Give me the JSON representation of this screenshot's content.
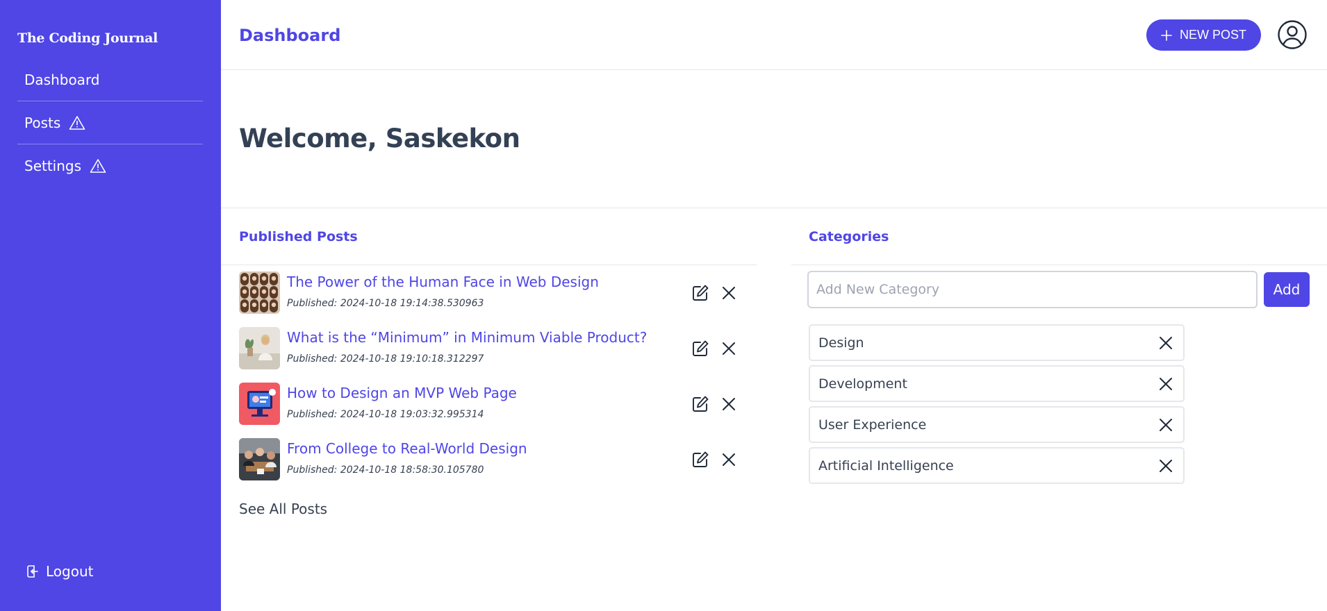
{
  "sidebar": {
    "brand": "The Coding Journal",
    "items": [
      {
        "label": "Dashboard",
        "warning": false
      },
      {
        "label": "Posts",
        "warning": true
      },
      {
        "label": "Settings",
        "warning": true
      }
    ],
    "logout_label": "Logout"
  },
  "header": {
    "title": "Dashboard",
    "new_post_label": "NEW POST"
  },
  "main": {
    "welcome": "Welcome, Saskekon"
  },
  "posts": {
    "heading": "Published Posts",
    "items": [
      {
        "title": "The Power of the Human Face in Web Design",
        "published": "Published: 2024-10-18 19:14:38.530963"
      },
      {
        "title": "What is the “Minimum” in Minimum Viable Product?",
        "published": "Published: 2024-10-18 19:10:18.312297"
      },
      {
        "title": "How to Design an MVP Web Page",
        "published": "Published: 2024-10-18 19:03:32.995314"
      },
      {
        "title": "From College to Real-World Design",
        "published": "Published: 2024-10-18 18:58:30.105780"
      }
    ],
    "see_all_label": "See All Posts"
  },
  "categories": {
    "heading": "Categories",
    "input_placeholder": "Add New Category",
    "add_label": "Add",
    "items": [
      "Design",
      "Development",
      "User Experience",
      "Artificial Intelligence"
    ]
  },
  "colors": {
    "accent": "#4f46e5",
    "sidebar_bg": "#4f46e5"
  }
}
